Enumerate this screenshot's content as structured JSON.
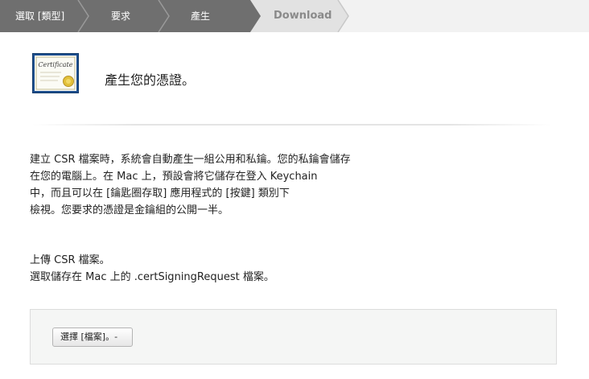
{
  "steps": {
    "items": [
      {
        "label": "選取 [類型]",
        "state": "done"
      },
      {
        "label": "要求",
        "state": "done"
      },
      {
        "label": "產生",
        "state": "done"
      },
      {
        "label": "Download",
        "state": "current"
      }
    ],
    "colors": {
      "done": "#6f6f6f",
      "current": "#e2e2e2",
      "rest": "#f2f2f2"
    }
  },
  "header": {
    "icon": "certificate-icon",
    "icon_text": "Certificate",
    "title": "產生您的憑證。"
  },
  "info": {
    "lines": [
      "建立 CSR 檔案時，系統會自動產生一組公用和私鑰。您的私鑰會儲存",
      "在您的電腦上。在 Mac 上，預設會將它儲存在登入 Keychain",
      "中，而且可以在 [鑰匙圈存取] 應用程式的 [按鍵] 類別下",
      "檢視。您要求的憑證是金鑰組的公開一半。"
    ]
  },
  "upload": {
    "heading": "上傳 CSR 檔案。",
    "description": "選取儲存在 Mac 上的 .certSigningRequest 檔案。",
    "choose_button": "選擇 [檔案]。-"
  }
}
